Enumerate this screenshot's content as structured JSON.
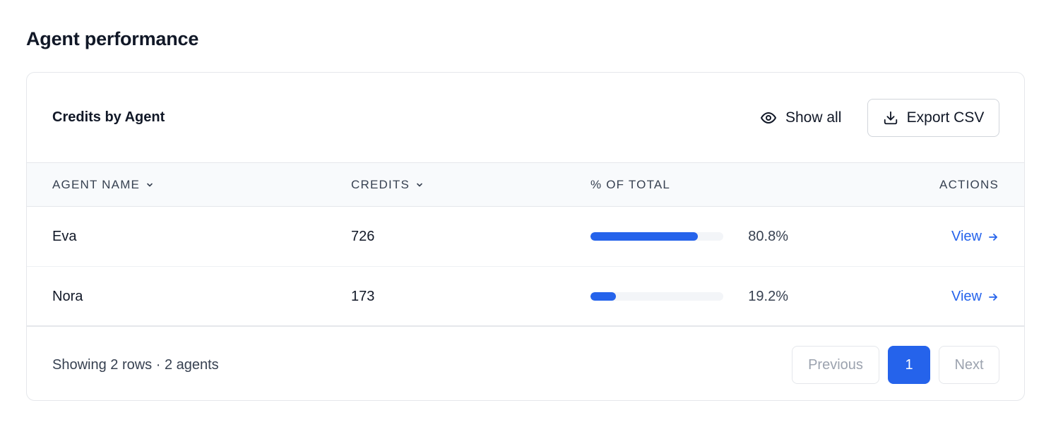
{
  "page": {
    "title": "Agent performance"
  },
  "card": {
    "title": "Credits by Agent",
    "show_all_label": "Show all",
    "export_label": "Export CSV"
  },
  "table": {
    "columns": {
      "agent_name": "AGENT NAME",
      "credits": "CREDITS",
      "pct_total": "% OF TOTAL",
      "actions": "ACTIONS"
    },
    "rows": [
      {
        "name": "Eva",
        "credits": "726",
        "pct_label": "80.8%",
        "pct_value": 80.8,
        "action": "View"
      },
      {
        "name": "Nora",
        "credits": "173",
        "pct_label": "19.2%",
        "pct_value": 19.2,
        "action": "View"
      }
    ]
  },
  "footer": {
    "summary": "Showing 2 rows · 2 agents",
    "pagination": {
      "previous": "Previous",
      "current": "1",
      "next": "Next"
    }
  },
  "colors": {
    "accent": "#2563eb",
    "border": "#e5e7eb",
    "header_bg": "#f8fafc"
  },
  "icons": {
    "show_all": "eye-icon",
    "export": "download-icon",
    "sort": "chevron-down-icon",
    "view": "arrow-right-icon"
  }
}
